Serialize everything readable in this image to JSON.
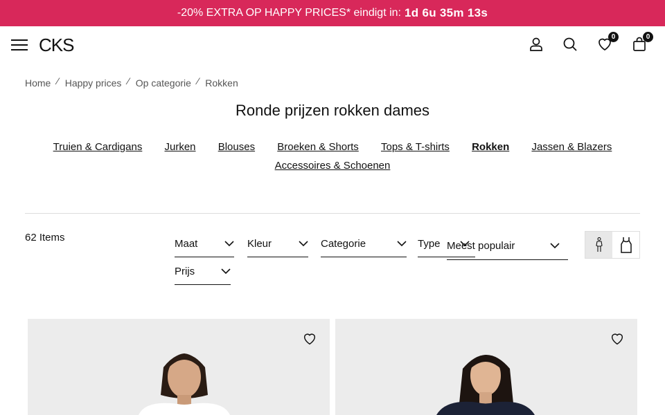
{
  "promo": {
    "text": "-20% EXTRA OP HAPPY PRICES* eindigt in:",
    "countdown": "1d 6u 35m 13s",
    "background": "#d8285a"
  },
  "header": {
    "logo": "CKS",
    "wishlist_count": "0",
    "cart_count": "0",
    "icons": [
      "menu-icon",
      "account-icon",
      "search-icon",
      "heart-icon",
      "bag-icon"
    ]
  },
  "breadcrumb": [
    "Home",
    "Happy prices",
    "Op categorie",
    "Rokken"
  ],
  "page_title": "Ronde prijzen rokken dames",
  "categories": [
    {
      "label": "Truien & Cardigans",
      "active": false
    },
    {
      "label": "Jurken",
      "active": false
    },
    {
      "label": "Blouses",
      "active": false
    },
    {
      "label": "Broeken & Shorts",
      "active": false
    },
    {
      "label": "Tops & T-shirts",
      "active": false
    },
    {
      "label": "Rokken",
      "active": true
    },
    {
      "label": "Jassen & Blazers",
      "active": false
    },
    {
      "label": "Accessoires & Schoenen",
      "active": false
    }
  ],
  "results": {
    "count": "62 Items"
  },
  "filters": {
    "maat": "Maat",
    "kleur": "Kleur",
    "categorie": "Categorie",
    "type": "Type",
    "prijs": "Prijs"
  },
  "sort": {
    "selected": "Meest populair"
  },
  "view": {
    "selected": "model-view"
  },
  "products": [
    {
      "wishlisted": false,
      "top_color": "#ffffff"
    },
    {
      "wishlisted": false,
      "top_color": "#1c2236"
    }
  ]
}
